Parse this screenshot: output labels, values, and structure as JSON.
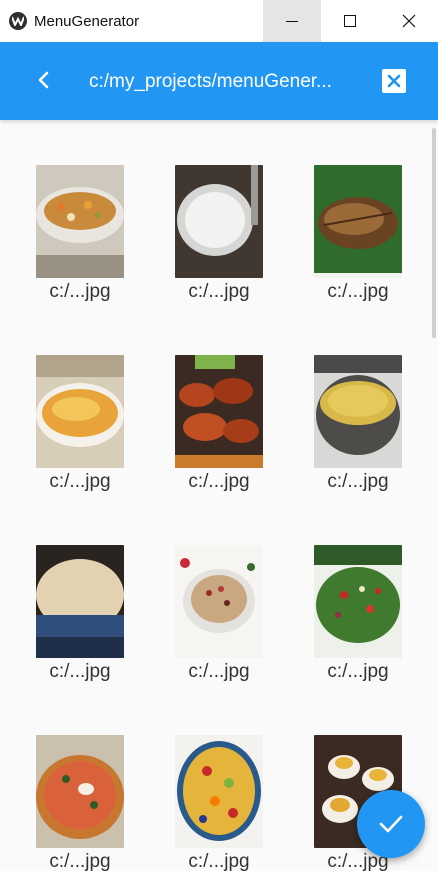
{
  "window": {
    "title": "MenuGenerator"
  },
  "appbar": {
    "path": "c:/my_projects/menuGener..."
  },
  "icons": {
    "back": "chevron-left-icon",
    "clear": "clear-box-icon",
    "confirm": "check-icon"
  },
  "colors": {
    "primary": "#2196f3",
    "background": "#fafafa"
  },
  "files": [
    {
      "caption": "c:/...jpg",
      "subject": "chicken soup"
    },
    {
      "caption": "c:/...jpg",
      "subject": "yogurt bowl"
    },
    {
      "caption": "c:/...jpg",
      "subject": "fried fish"
    },
    {
      "caption": "c:/...jpg",
      "subject": "casserole"
    },
    {
      "caption": "c:/...jpg",
      "subject": "chicken wings"
    },
    {
      "caption": "c:/...jpg",
      "subject": "couscous"
    },
    {
      "caption": "c:/...jpg",
      "subject": "oatmeal"
    },
    {
      "caption": "c:/...jpg",
      "subject": "granola bowl"
    },
    {
      "caption": "c:/...jpg",
      "subject": "salad"
    },
    {
      "caption": "c:/...jpg",
      "subject": "pizza"
    },
    {
      "caption": "c:/...jpg",
      "subject": "fruit salad"
    },
    {
      "caption": "c:/...jpg",
      "subject": "deviled eggs"
    }
  ]
}
